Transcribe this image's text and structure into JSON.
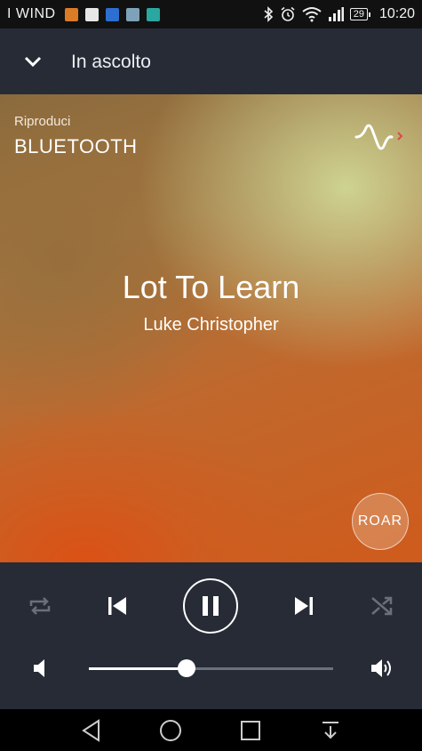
{
  "status_bar": {
    "carrier": "I WIND",
    "battery": "29",
    "time": "10:20",
    "notification_icons": [
      "message-icon",
      "document-icon",
      "calendar-icon",
      "gallery-icon",
      "cast-icon"
    ],
    "system_icons": [
      "bluetooth-icon",
      "alarm-icon",
      "wifi-icon",
      "signal-icon",
      "battery-icon"
    ]
  },
  "header": {
    "title": "In ascolto",
    "back_icon": "chevron-down-icon"
  },
  "now_playing": {
    "source_label": "Riproduci",
    "source_name": "BLUETOOTH",
    "song_title": "Lot To Learn",
    "artist": "Luke Christopher",
    "roar_label": "ROAR",
    "accent_colors": {
      "orange": "#cf5b1c",
      "greenish": "#c4c88c"
    }
  },
  "controls": {
    "repeat_icon": "repeat-icon",
    "previous_icon": "skip-previous-icon",
    "play_pause_icon": "pause-icon",
    "next_icon": "skip-next-icon",
    "shuffle_icon": "shuffle-icon",
    "volume_level": 0.4
  },
  "nav_bar": {
    "icons": [
      "back-icon",
      "home-icon",
      "recents-icon",
      "notifications-pulldown-icon"
    ]
  }
}
